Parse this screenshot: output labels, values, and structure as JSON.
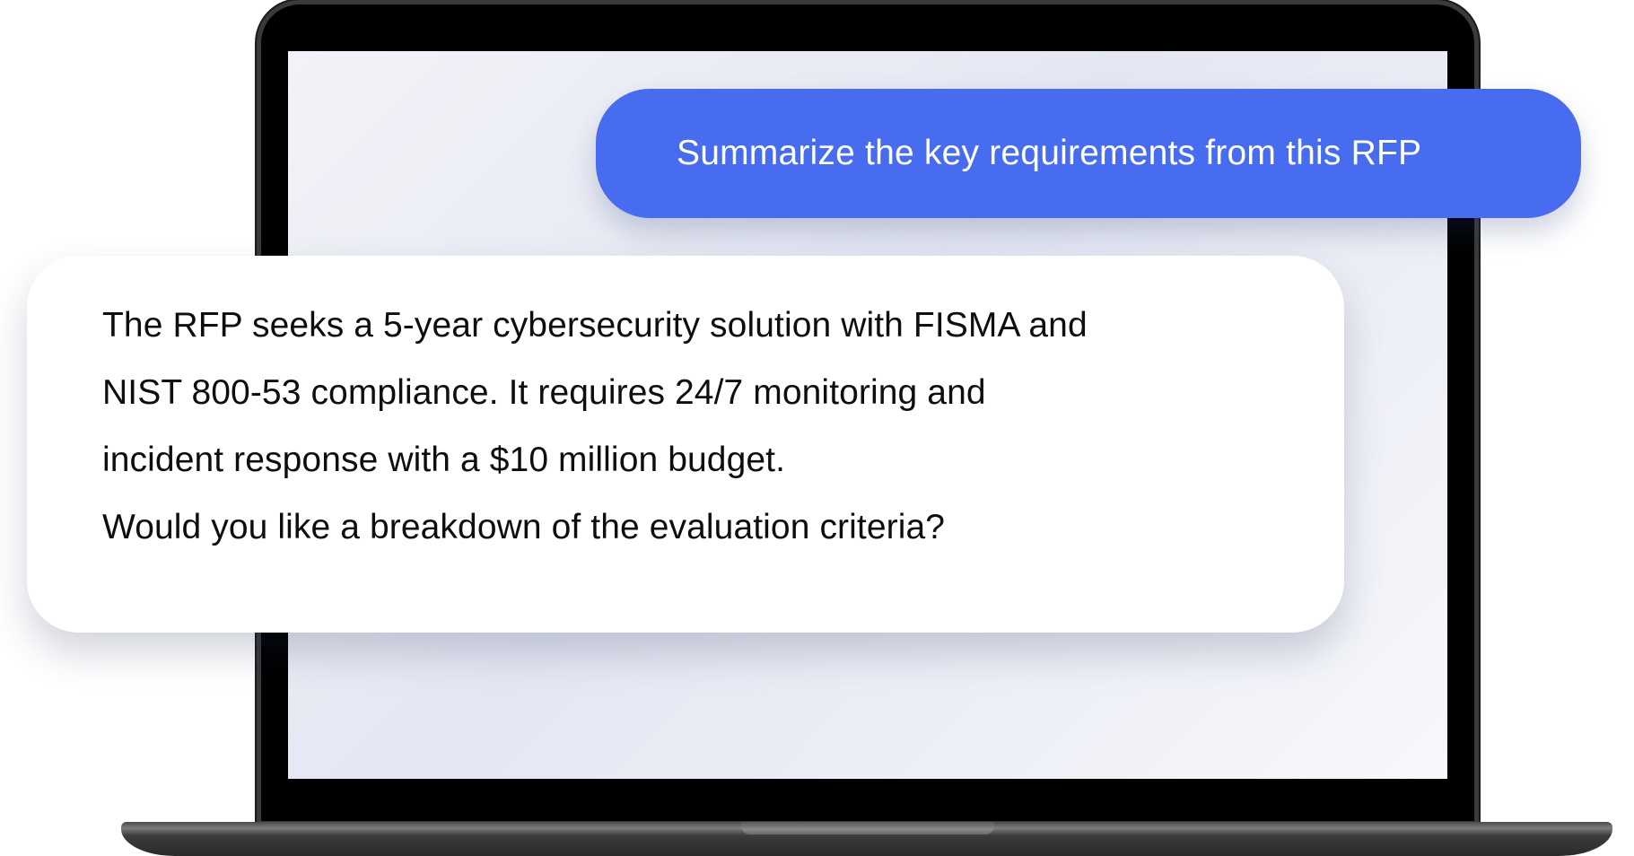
{
  "prompt": {
    "text": "Summarize the key requirements from this RFP"
  },
  "response": {
    "lines": [
      "The RFP seeks a 5-year cybersecurity solution with FISMA and",
      "NIST 800-53 compliance. It requires 24/7 monitoring and",
      "incident response with a $10 million budget.",
      "Would you like a breakdown of the evaluation criteria?"
    ]
  },
  "colors": {
    "prompt_bubble": "#476cf0",
    "prompt_text": "#ffffff",
    "response_bubble": "#ffffff",
    "response_text": "#0d0d12",
    "laptop_bezel": "#000000"
  }
}
